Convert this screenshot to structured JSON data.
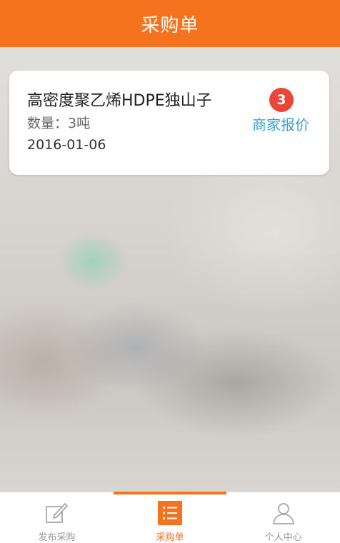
{
  "header": {
    "title": "采购单"
  },
  "orders": [
    {
      "title": "高密度聚乙烯HDPE独山子",
      "quantity": "数量：3吨",
      "date": "2016-01-06",
      "quote_count": "3",
      "quote_label": "商家报价"
    }
  ],
  "tabbar": {
    "tabs": [
      {
        "label": "发布采购",
        "icon": "edit-icon",
        "active": false
      },
      {
        "label": "采购单",
        "icon": "list-icon",
        "active": true
      },
      {
        "label": "个人中心",
        "icon": "user-icon",
        "active": false
      }
    ]
  },
  "colors": {
    "accent": "#f5721f",
    "badge": "#e94538",
    "link": "#3aa3d6"
  }
}
